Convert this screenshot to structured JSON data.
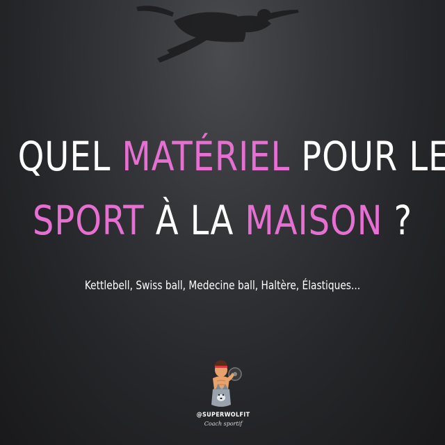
{
  "headline": {
    "line1": {
      "w1": "QUEL ",
      "w2": "MATÉRIEL",
      "w3": " POUR LE"
    },
    "line2": {
      "w1": "SPORT",
      "w2": " À LA ",
      "w3": "MAISON",
      "w4": " ?"
    }
  },
  "subtitle": "Kettlebell, Swiss ball, Medecine ball, Haltère, Élastiques...",
  "logo": {
    "handle": "@SUPERWOLFIT",
    "tagline": "Coach sportif"
  },
  "colors": {
    "accent": "#e66fd2",
    "text": "#ffffff",
    "background": "#26272a"
  }
}
